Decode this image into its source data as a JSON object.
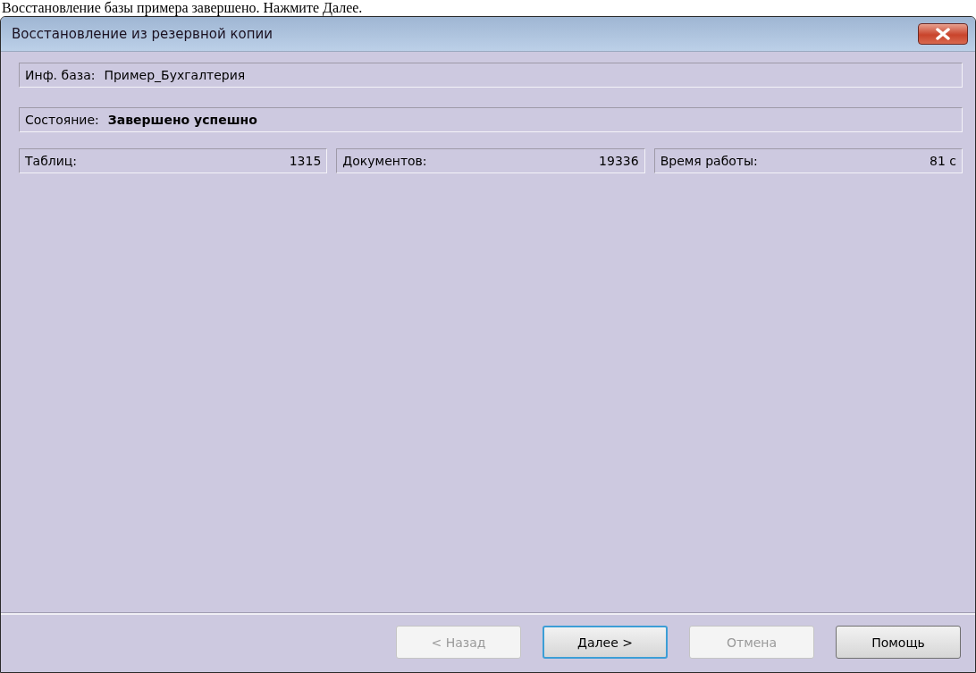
{
  "caption": "Восстановление базы примера завершено. Нажмите Далее.",
  "window": {
    "title": "Восстановление из резервной копии"
  },
  "info_base": {
    "label": "Инф. база:",
    "value": "Пример_Бухгалтерия"
  },
  "status": {
    "label": "Состояние:",
    "value": "Завершено успешно"
  },
  "stats": [
    {
      "label": "Таблиц:",
      "value": "1315"
    },
    {
      "label": "Документов:",
      "value": "19336"
    },
    {
      "label": "Время работы:",
      "value": "81 с"
    }
  ],
  "buttons": [
    {
      "label": "< Назад",
      "disabled": true,
      "default": false
    },
    {
      "label": "Далее >",
      "disabled": false,
      "default": true
    },
    {
      "label": "Отмена",
      "disabled": true,
      "default": false
    },
    {
      "label": "Помощь",
      "disabled": false,
      "default": false
    }
  ]
}
